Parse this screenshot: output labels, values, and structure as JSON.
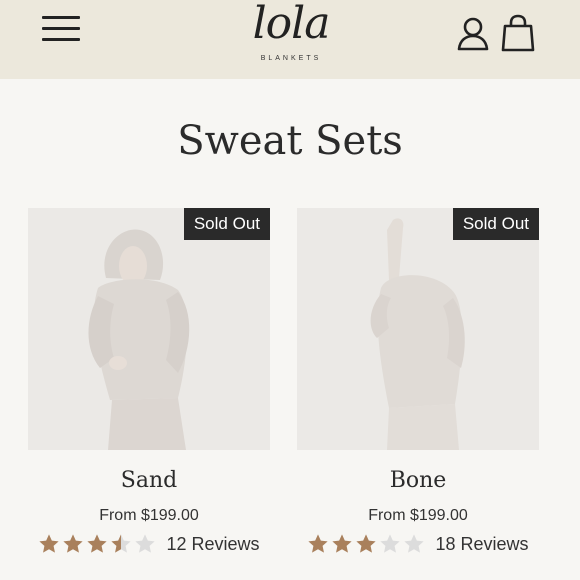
{
  "header": {
    "logo_text": "lola",
    "logo_subtext": "BLANKETS",
    "menu_icon": "hamburger-menu-icon",
    "account_icon": "user-icon",
    "cart_icon": "shopping-bag-icon"
  },
  "page": {
    "title": "Sweat Sets"
  },
  "products": [
    {
      "name": "Sand",
      "badge": "Sold Out",
      "price": "From $199.00",
      "rating": 3.5,
      "reviews": "12 Reviews"
    },
    {
      "name": "Bone",
      "badge": "Sold Out",
      "price": "From $199.00",
      "rating": 3,
      "reviews": "18 Reviews"
    }
  ],
  "colors": {
    "header_bg": "#ece8dc",
    "page_bg": "#f7f6f3",
    "star_filled": "#a9805c",
    "star_empty": "#dcdcdc",
    "badge_bg": "#2a2a2a"
  }
}
